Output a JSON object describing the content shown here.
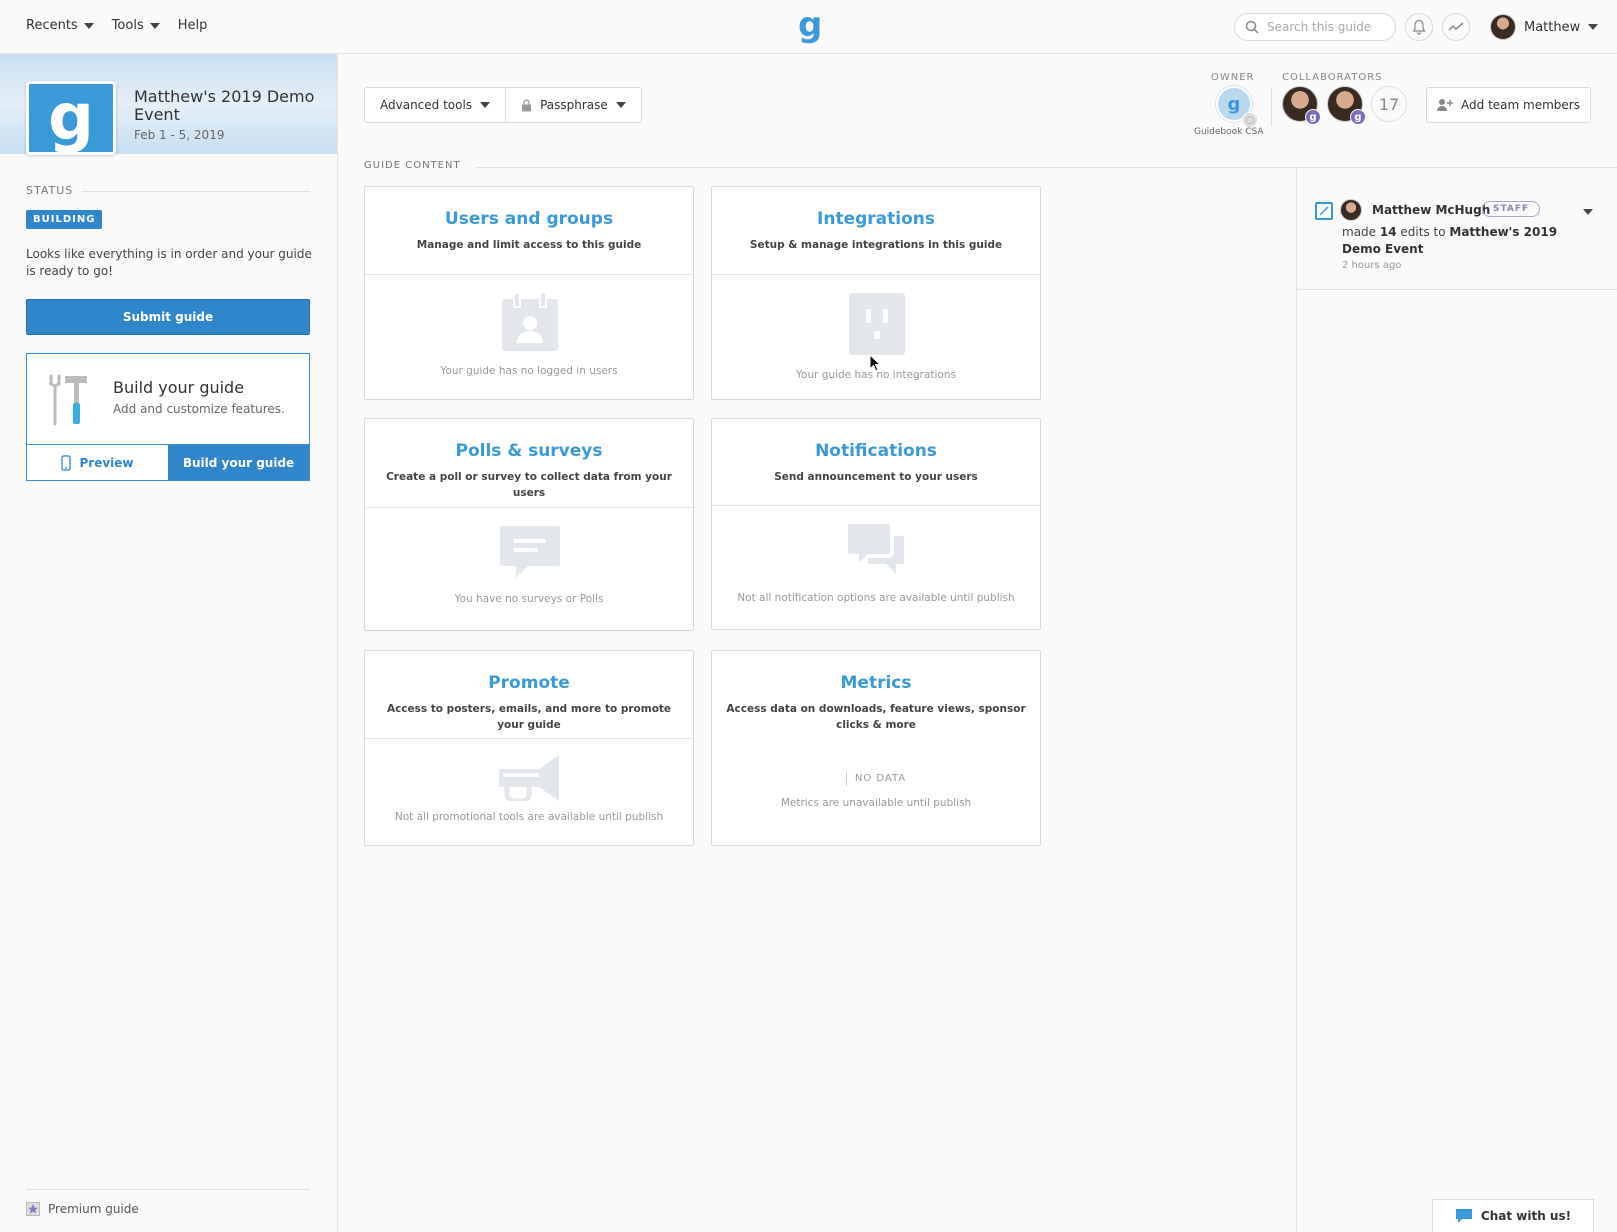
{
  "topnav": {
    "recents": "Recents",
    "tools": "Tools",
    "help": "Help",
    "brand": "g",
    "search_placeholder": "Search this guide",
    "user_name": "Matthew"
  },
  "sidebar": {
    "logo_letter": "g",
    "guide_title": "Matthew's 2019 Demo Event",
    "guide_dates": "Feb 1 - 5, 2019",
    "status_label": "STATUS",
    "status_badge": "BUILDING",
    "status_message": "Looks like everything is in order and your guide is ready to go!",
    "submit_label": "Submit guide",
    "build_title": "Build your guide",
    "build_subtitle": "Add and customize features.",
    "preview_label": "Preview",
    "build_button_label": "Build your guide",
    "footer_label": "Premium guide"
  },
  "toolbar": {
    "advanced_tools": "Advanced tools",
    "passphrase": "Passphrase"
  },
  "team": {
    "owner_label": "OWNER",
    "owner_name": "Guidebook CSA",
    "collaborators_label": "COLLABORATORS",
    "collaborators_count": "17",
    "add_team_label": "Add team members"
  },
  "content": {
    "section_label": "GUIDE CONTENT",
    "cards": [
      {
        "title": "Users and groups",
        "desc": "Manage and limit access to this guide",
        "empty": "Your guide has no logged in users",
        "icon": "user-badge-icon"
      },
      {
        "title": "Integrations",
        "desc": "Setup & manage integrations in this guide",
        "empty": "Your guide has no integrations",
        "icon": "outlet-icon"
      },
      {
        "title": "Polls & surveys",
        "desc": "Create a poll or survey to collect data from your users",
        "empty": "You have no surveys or Polls",
        "icon": "speech-bubble-icon"
      },
      {
        "title": "Notifications",
        "desc": "Send announcement to your users",
        "empty": "Not all notification options are available until publish",
        "icon": "chat-bubbles-icon"
      },
      {
        "title": "Promote",
        "desc": "Access to posters, emails, and more to promote your guide",
        "empty": "Not all promotional tools are available until publish",
        "icon": "megaphone-icon"
      },
      {
        "title": "Metrics",
        "desc": "Access data on downloads, feature views, sponsor clicks & more",
        "empty": "Metrics are unavailable until publish",
        "no_data": "NO DATA",
        "icon": "chart-icon"
      }
    ]
  },
  "feed": {
    "user_name": "Matthew McHugh",
    "badge": "STAFF",
    "text_prefix": "made",
    "edit_count": "14",
    "text_mid": "edits to",
    "guide_name": "Matthew's 2019 Demo Event",
    "time": "2 hours ago"
  },
  "chat": {
    "label": "Chat with us!"
  },
  "colors": {
    "accent": "#3a9ad9",
    "primary_button": "#2f86cb",
    "staff_badge": "#8a8ab5",
    "collaborator_badge": "#7b6bb5"
  }
}
